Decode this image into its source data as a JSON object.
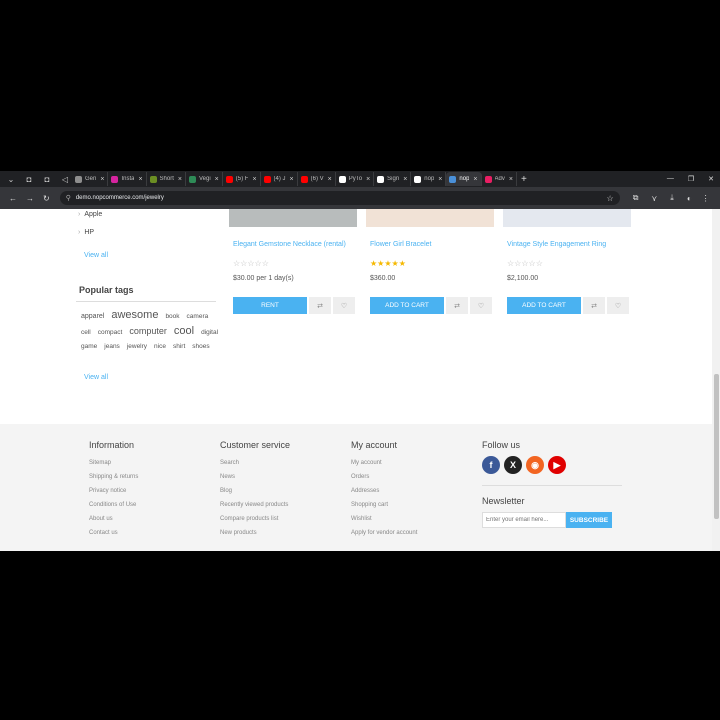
{
  "browser": {
    "tabs": [
      {
        "title": "Gen",
        "favicon_color": "#8e8e8e"
      },
      {
        "title": "Insta",
        "favicon_color": "#d6249f"
      },
      {
        "title": "Short",
        "favicon_color": "#6b8e23"
      },
      {
        "title": "Vegi",
        "favicon_color": "#2e8b57"
      },
      {
        "title": "(5) F",
        "favicon_color": "#ff0000"
      },
      {
        "title": "(4) J",
        "favicon_color": "#ff0000"
      },
      {
        "title": "(6) V",
        "favicon_color": "#ff0000"
      },
      {
        "title": "PyTo",
        "favicon_color": "#ffffff"
      },
      {
        "title": "Sign",
        "favicon_color": "#ffffff"
      },
      {
        "title": "nop",
        "favicon_color": "#ffffff"
      },
      {
        "title": "nop",
        "favicon_color": "#4a90d9"
      },
      {
        "title": "Adv",
        "favicon_color": "#e91e63"
      }
    ],
    "url": "demo.nopcommerce.com/jewelry"
  },
  "sidebar": {
    "manufacturers": [
      "Apple",
      "HP"
    ],
    "view_all": "View all",
    "popular_tags_title": "Popular tags",
    "tags": [
      {
        "label": "apparel",
        "size": 7
      },
      {
        "label": "awesome",
        "size": 11
      },
      {
        "label": "book",
        "size": 6.5
      },
      {
        "label": "camera",
        "size": 6.5
      },
      {
        "label": "cell",
        "size": 6.5
      },
      {
        "label": "compact",
        "size": 6.5
      },
      {
        "label": "computer",
        "size": 9
      },
      {
        "label": "cool",
        "size": 11
      },
      {
        "label": "digital",
        "size": 6.5
      },
      {
        "label": "game",
        "size": 6.5
      },
      {
        "label": "jeans",
        "size": 6.5
      },
      {
        "label": "jewelry",
        "size": 6.5
      },
      {
        "label": "nice",
        "size": 6.5
      },
      {
        "label": "shirt",
        "size": 6.5
      },
      {
        "label": "shoes",
        "size": 6.5
      }
    ],
    "tags_view_all": "View all"
  },
  "products": [
    {
      "name": "Elegant Gemstone Necklace (rental)",
      "stars": "☆☆☆☆☆",
      "rating_filled": false,
      "price": "$30.00 per 1 day(s)",
      "button": "RENT",
      "image_color": "#b8bcbc"
    },
    {
      "name": "Flower Girl Bracelet",
      "stars": "★★★★★",
      "rating_filled": true,
      "price": "$360.00",
      "button": "ADD TO CART",
      "image_color": "#f1e2d6"
    },
    {
      "name": "Vintage Style Engagement Ring",
      "stars": "☆☆☆☆☆",
      "rating_filled": false,
      "price": "$2,100.00",
      "button": "ADD TO CART",
      "image_color": "#e4e8ef"
    }
  ],
  "footer": {
    "information": {
      "title": "Information",
      "items": [
        "Sitemap",
        "Shipping & returns",
        "Privacy notice",
        "Conditions of Use",
        "About us",
        "Contact us"
      ]
    },
    "customer_service": {
      "title": "Customer service",
      "items": [
        "Search",
        "News",
        "Blog",
        "Recently viewed products",
        "Compare products list",
        "New products"
      ]
    },
    "my_account": {
      "title": "My account",
      "items": [
        "My account",
        "Orders",
        "Addresses",
        "Shopping cart",
        "Wishlist",
        "Apply for vendor account"
      ]
    },
    "follow_us": {
      "title": "Follow us",
      "networks": [
        {
          "name": "facebook",
          "glyph": "f",
          "color": "#3b5998"
        },
        {
          "name": "x",
          "glyph": "X",
          "color": "#222222"
        },
        {
          "name": "rss",
          "glyph": "◉",
          "color": "#f26522"
        },
        {
          "name": "youtube",
          "glyph": "▶",
          "color": "#e00000"
        }
      ]
    },
    "newsletter": {
      "title": "Newsletter",
      "placeholder": "Enter your email here...",
      "button": "SUBSCRIBE"
    }
  }
}
